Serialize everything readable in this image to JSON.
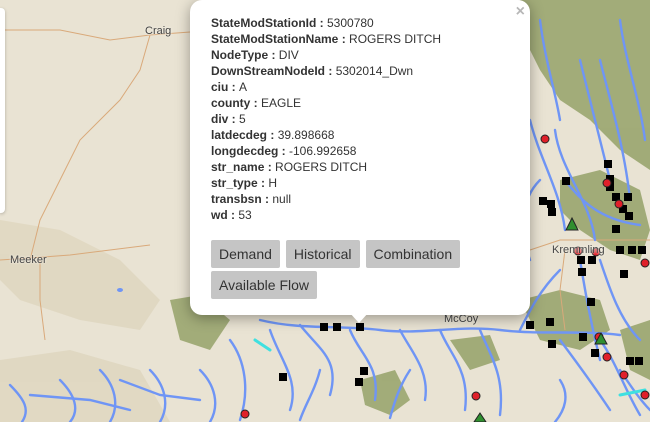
{
  "map": {
    "labels": [
      "Craig",
      "Meeker",
      "Kremmling",
      "McCoy"
    ]
  },
  "popup": {
    "close_label": "×",
    "attributes": [
      {
        "key": "StateModStationId",
        "value": "5300780"
      },
      {
        "key": "StateModStationName",
        "value": "ROGERS DITCH"
      },
      {
        "key": "NodeType",
        "value": "DIV"
      },
      {
        "key": "DownStreamNodeId",
        "value": "5302014_Dwn"
      },
      {
        "key": "ciu",
        "value": "A"
      },
      {
        "key": "county",
        "value": "EAGLE"
      },
      {
        "key": "div",
        "value": "5"
      },
      {
        "key": "latdecdeg",
        "value": "39.898668"
      },
      {
        "key": "longdecdeg",
        "value": "-106.992658"
      },
      {
        "key": "str_name",
        "value": "ROGERS DITCH"
      },
      {
        "key": "str_type",
        "value": "H"
      },
      {
        "key": "transbsn",
        "value": "null"
      },
      {
        "key": "wd",
        "value": "53"
      }
    ],
    "buttons": [
      "Demand",
      "Historical",
      "Combination",
      "Available Flow"
    ]
  },
  "colors": {
    "rivers": "#6f95f5",
    "terrain": "#e9e3d3",
    "forest": "#9aa56f",
    "station_marker": "#000000",
    "red_marker": "#e0202a",
    "green_marker": "#2f8f2f",
    "highlight_stream": "#3fe0e0"
  }
}
